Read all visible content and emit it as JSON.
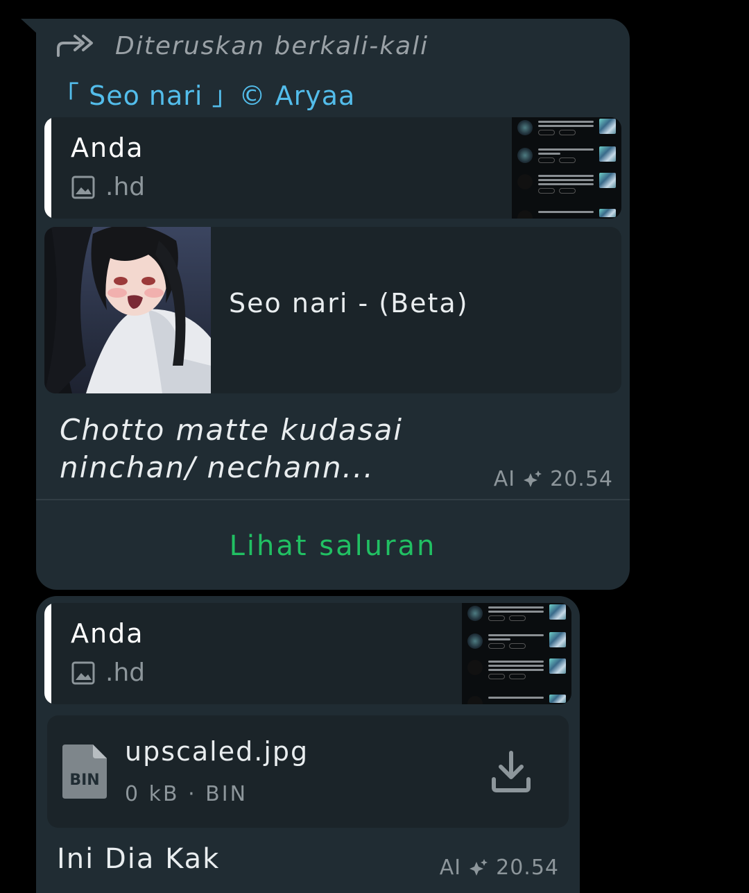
{
  "message1": {
    "forwarded_label": "Diteruskan berkali-kali",
    "sender_name": "「 Seo nari 」© Aryaa",
    "quote": {
      "author": "Anda",
      "text": ".hd",
      "media_icon": "image-icon"
    },
    "link_preview": {
      "title": "Seo nari - (Beta)"
    },
    "caption": "Chotto matte kudasai ninchan/ nechann...",
    "meta": {
      "prefix": "AI",
      "icon": "ai-sparkle-icon",
      "time": "20.54"
    },
    "action_label": "Lihat saluran"
  },
  "message2": {
    "quote": {
      "author": "Anda",
      "text": ".hd",
      "media_icon": "image-icon"
    },
    "file": {
      "badge": "BIN",
      "name": "upscaled.jpg",
      "details": "0 kB · BIN",
      "action_icon": "download-icon"
    },
    "caption": "Ini Dia Kak",
    "meta": {
      "prefix": "AI",
      "icon": "ai-sparkle-icon",
      "time": "20.54"
    }
  },
  "colors": {
    "bubble": "#202c33",
    "card": "#1b2429",
    "sender": "#53bdeb",
    "action": "#21c063",
    "muted": "#8d969b",
    "text": "#e9edef"
  }
}
